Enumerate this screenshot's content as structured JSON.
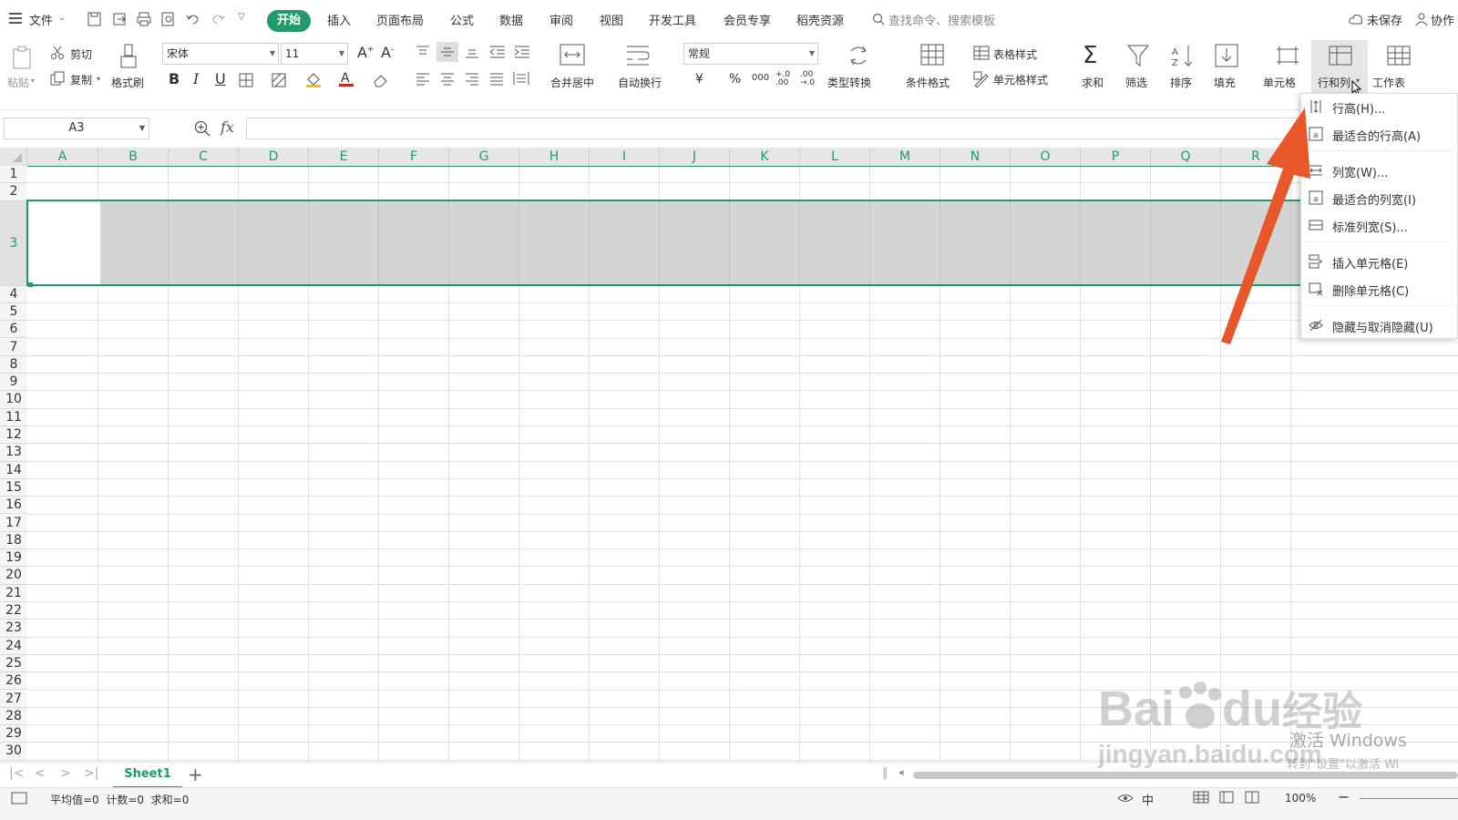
{
  "menubar": {
    "file_label": "文件",
    "active_tab": "开始",
    "tabs": [
      "插入",
      "页面布局",
      "公式",
      "数据",
      "审阅",
      "视图",
      "开发工具",
      "会员专享",
      "稻壳资源"
    ],
    "search_placeholder": "查找命令、搜索模板",
    "unsaved_label": "未保存",
    "collab_label": "协作"
  },
  "ribbon": {
    "paste": "粘贴",
    "cut": "剪切",
    "copy": "复制",
    "format_painter": "格式刷",
    "font_name": "宋体",
    "font_size": "11",
    "merge_center": "合并居中",
    "wrap_text": "自动换行",
    "number_format": "常规",
    "type_convert": "类型转换",
    "conditional_format": "条件格式",
    "table_style": "表格样式",
    "cell_style": "单元格样式",
    "sum": "求和",
    "filter": "筛选",
    "sort": "排序",
    "fill": "填充",
    "cell": "单元格",
    "row_col": "行和列",
    "worksheet": "工作表"
  },
  "formula_bar": {
    "name_box": "A3",
    "fx": "fx"
  },
  "grid": {
    "columns": [
      "A",
      "B",
      "C",
      "D",
      "E",
      "F",
      "G",
      "H",
      "I",
      "J",
      "K",
      "L",
      "M",
      "N",
      "O",
      "P",
      "Q",
      "R"
    ],
    "rows": [
      "1",
      "2",
      "3",
      "4",
      "5",
      "6",
      "7",
      "8",
      "9",
      "10",
      "11",
      "12",
      "13",
      "14",
      "15",
      "16",
      "17",
      "18",
      "19",
      "20",
      "21",
      "22",
      "23",
      "24",
      "25",
      "26",
      "27",
      "28",
      "29",
      "30"
    ],
    "selected_row": "3"
  },
  "context_menu": {
    "items": [
      {
        "label": "行高(H)..."
      },
      {
        "label": "最适合的行高(A)"
      },
      {
        "label": "列宽(W)..."
      },
      {
        "label": "最适合的列宽(I)"
      },
      {
        "label": "标准列宽(S)..."
      },
      {
        "label": "插入单元格(E)"
      },
      {
        "label": "删除单元格(C)"
      },
      {
        "label": "隐藏与取消隐藏(U)"
      }
    ]
  },
  "sheets": {
    "active": "Sheet1"
  },
  "status": {
    "summary": "平均值=0  计数=0  求和=0",
    "zoom": "100%"
  },
  "watermark": {
    "baidu": "Bai",
    "baidu2": "du",
    "jingyan": "经验",
    "activate": "激活 Windows",
    "url": "jingyan.baidu.com",
    "activate_hint": "转到\"设置\"以激活 Wi"
  },
  "colors": {
    "accent": "#1e9c6a",
    "arrow": "#e8572a",
    "selection_fill": "#d4d4d4"
  }
}
